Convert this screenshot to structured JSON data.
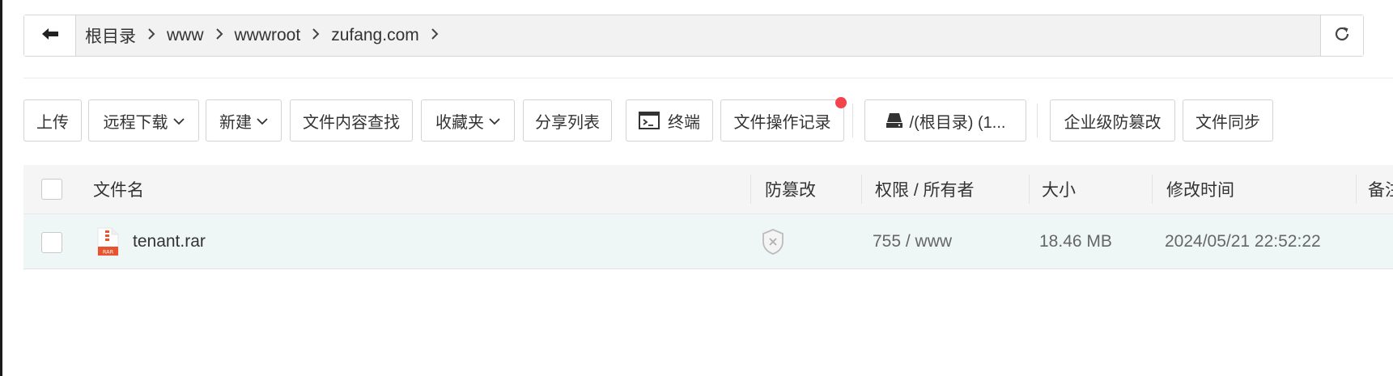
{
  "path_bar": {
    "crumbs": [
      "根目录",
      "www",
      "wwwroot",
      "zufang.com"
    ]
  },
  "toolbar": {
    "upload": "上传",
    "remote_download": "远程下载",
    "new": "新建",
    "content_search": "文件内容查找",
    "favorites": "收藏夹",
    "share_list": "分享列表",
    "terminal": "终端",
    "operation_log": "文件操作记录",
    "disk": "/(根目录) (1...",
    "tamper_proof_enterprise": "企业级防篡改",
    "file_sync": "文件同步"
  },
  "table": {
    "columns": {
      "name": "文件名",
      "tamper": "防篡改",
      "perm_owner": "权限 / 所有者",
      "size": "大小",
      "mtime": "修改时间",
      "note": "备注"
    },
    "rows": [
      {
        "name": "tenant.rar",
        "file_icon_text": "RAR",
        "perm_owner": "755 / www",
        "size": "18.46 MB",
        "mtime": "2024/05/21 22:52:22"
      }
    ]
  },
  "colors": {
    "row_highlight": "#eef7f5",
    "notify_dot": "#f5434d",
    "rar_icon": "#e8542f"
  },
  "icons": [
    "back-arrow-icon",
    "chevron-right-icon",
    "refresh-icon",
    "chevron-down-icon",
    "terminal-icon",
    "disk-icon",
    "shield-x-icon",
    "rar-file-icon"
  ]
}
